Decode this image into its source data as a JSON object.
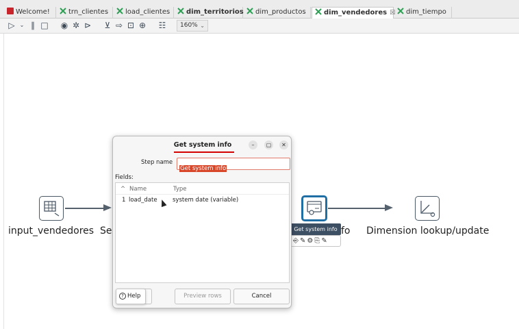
{
  "tabs": [
    {
      "label": "Welcome!",
      "icon": "welcome-icon",
      "bold": false,
      "active": false
    },
    {
      "label": "trn_clientes",
      "icon": "transformation-icon",
      "bold": false,
      "active": false
    },
    {
      "label": "load_clientes",
      "icon": "transformation-icon",
      "bold": false,
      "active": false
    },
    {
      "label": "dim_territorios",
      "icon": "transformation-icon",
      "bold": true,
      "active": false
    },
    {
      "label": "dim_productos",
      "icon": "transformation-icon",
      "bold": false,
      "active": false
    },
    {
      "label": "dim_vendedores",
      "icon": "transformation-icon",
      "bold": true,
      "active": true,
      "close": "☒"
    },
    {
      "label": "dim_tiempo",
      "icon": "transformation-icon",
      "bold": false,
      "active": false
    }
  ],
  "toolbar": {
    "zoom_value": "160%",
    "icons": [
      "run-icon",
      "dropdown-icon",
      "pause-icon",
      "stop-icon",
      "preview-icon",
      "debug-icon",
      "replay-icon",
      "verify-icon",
      "impact-icon",
      "sql-icon",
      "explore-db-icon",
      "align-icon"
    ]
  },
  "canvas": {
    "steps": [
      {
        "label": "input_vendedores",
        "icon": "table-input-icon"
      },
      {
        "label": "Se",
        "icon": ""
      },
      {
        "label": "fo",
        "icon": "system-info-icon",
        "selected": true
      },
      {
        "label": "Dimension lookup/update",
        "icon": "dimension-lookup-icon"
      }
    ],
    "tooltip": "Get system info",
    "mini_tools": "⎆✎⚙⎘✎"
  },
  "dialog": {
    "title": "Get system info",
    "minimize": "–",
    "maximize": "▢",
    "close": "✕",
    "step_name_label": "Step name",
    "step_name_value": "Get system info",
    "fields_label": "Fields:",
    "columns": {
      "sort": "^",
      "name": "Name",
      "type": "Type"
    },
    "rows": [
      {
        "num": "1",
        "name": "load_date",
        "type": "system date (variable)"
      }
    ],
    "buttons": {
      "help": "Help",
      "ok_partial": "(",
      "preview": "Preview rows",
      "cancel": "Cancel"
    }
  }
}
